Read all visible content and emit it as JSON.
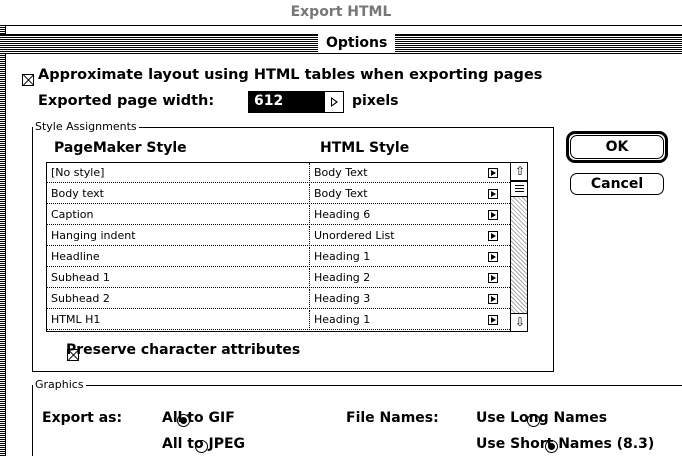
{
  "window": {
    "title": "Export HTML"
  },
  "tab": {
    "label": "Options"
  },
  "layout": {
    "approx_label": "Approximate layout using HTML tables when exporting pages",
    "width_label": "Exported page width:",
    "width_value": "612",
    "width_unit": "pixels"
  },
  "style_group": {
    "label": "Style Assignments",
    "col1": "PageMaker Style",
    "col2": "HTML Style",
    "rows": [
      {
        "pm": "[No style]",
        "html": "Body Text"
      },
      {
        "pm": "Body text",
        "html": "Body Text"
      },
      {
        "pm": "Caption",
        "html": "Heading 6"
      },
      {
        "pm": "Hanging indent",
        "html": "Unordered List"
      },
      {
        "pm": "Headline",
        "html": "Heading 1"
      },
      {
        "pm": "Subhead 1",
        "html": "Heading 2"
      },
      {
        "pm": "Subhead 2",
        "html": "Heading 3"
      },
      {
        "pm": "HTML H1",
        "html": "Heading 1"
      }
    ],
    "preserve_label": "Preserve character attributes"
  },
  "buttons": {
    "ok": "OK",
    "cancel": "Cancel"
  },
  "graphics": {
    "label": "Graphics",
    "export_as": "Export as:",
    "gif": "All to GIF",
    "jpeg": "All to JPEG",
    "file_names": "File Names:",
    "long": "Use Long Names",
    "short": "Use Short Names (8.3)",
    "selected_export": "gif",
    "selected_names": "short"
  }
}
